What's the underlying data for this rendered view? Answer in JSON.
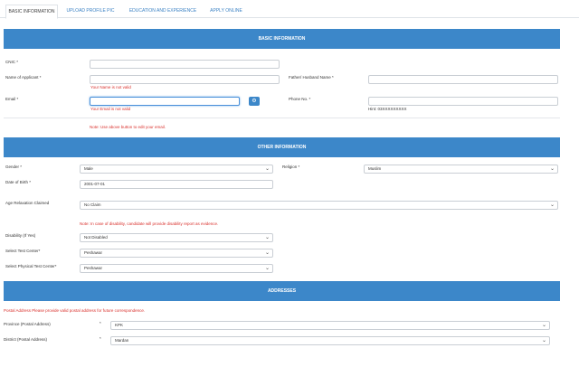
{
  "tabs": [
    {
      "label": "BASIC INFORMATION",
      "active": true
    },
    {
      "label": "UPLOAD PROFILE PIC",
      "active": false
    },
    {
      "label": "EDUCATION AND EXPERIENCE",
      "active": false
    },
    {
      "label": "APPLY ONLINE",
      "active": false
    }
  ],
  "sections": {
    "basic": "BASIC INFORMATION",
    "other": "OTHER INFORMATION",
    "addresses": "ADDRESSES"
  },
  "basic": {
    "cnic_label": "CNIC *",
    "cnic_value": "",
    "name_label": "Name of Applicant *",
    "name_value": "",
    "name_error": "Your Name is not valid",
    "father_label": "Father/ Husband Name *",
    "father_value": "",
    "email_label": "Email *",
    "email_value": "",
    "email_error": "Your Email is not valid",
    "email_note": "Note: Use above button to edit your email.",
    "phone_label": "Phone No. *",
    "phone_value": "",
    "phone_hint": "Hint: 03XXXXXXXXX"
  },
  "other": {
    "gender_label": "Gender *",
    "gender_value": "Male",
    "religion_label": "Religion *",
    "religion_value": "Muslim",
    "dob_label": "Date of Birth *",
    "dob_value": "2001-07-01",
    "age_label": "Age Relaxation Claimed",
    "age_value": "No Claim",
    "disability_note": "Note: In case of disability, candidate will provide disability report as evidence.",
    "disability_label": "Disability (If Yes)",
    "disability_value": "Not Disabled",
    "test_center_label": "Select Test Center*",
    "test_center_value": "Peshawar",
    "physical_center_label": "Select Physical Test Center*",
    "physical_center_value": "Peshawar"
  },
  "addresses": {
    "postal_note": "Postal Address Please provide valid postal address for future correspondence.",
    "province_label": "Province (Postal Address)",
    "province_star": "*",
    "province_value": "KPK",
    "district_label": "District (Postal Address)",
    "district_star": "*",
    "district_value": "Mardan"
  },
  "icons": {
    "edit_email": "gear-icon",
    "dropdown": "chevron-down-icon"
  },
  "colors": {
    "accent": "#3c87c9",
    "error": "#d9302c"
  }
}
